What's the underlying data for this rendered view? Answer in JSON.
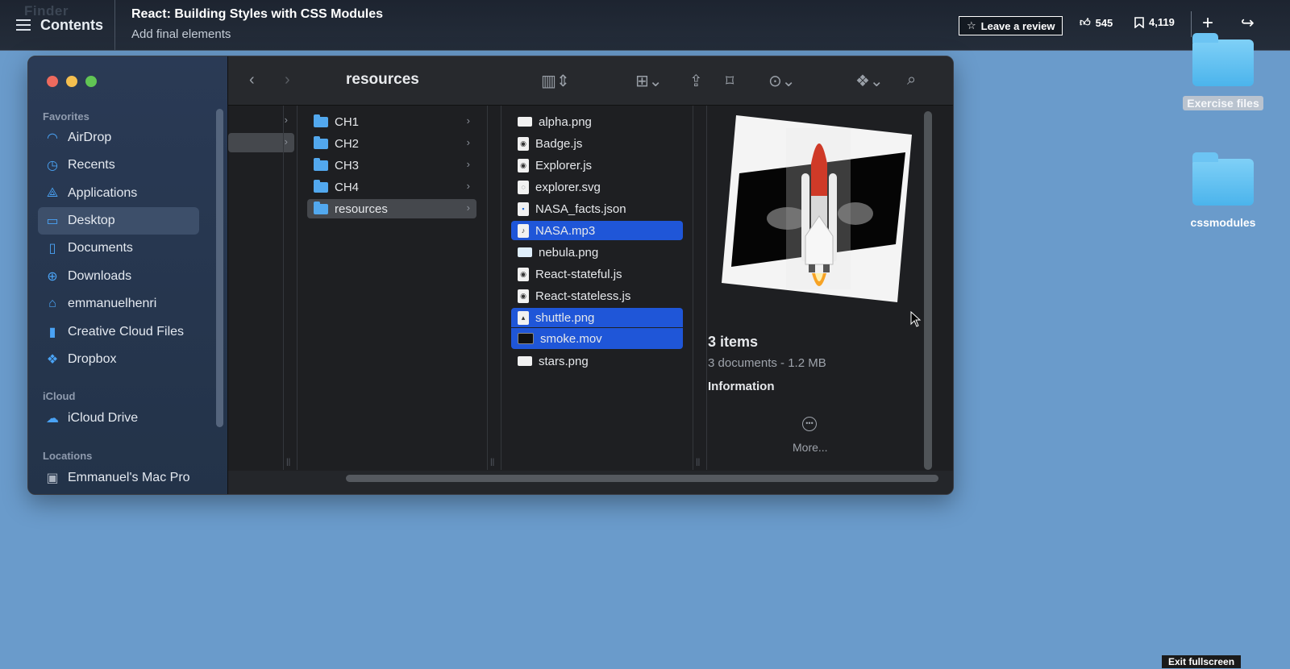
{
  "topbar": {
    "ghost_menu": "Finder",
    "contents_label": "Contents",
    "course_title": "React: Building Styles with CSS Modules",
    "video_title": "Add final elements",
    "review_label": "Leave a review",
    "likes": "545",
    "saves": "4,119"
  },
  "desktop": {
    "folders": [
      {
        "label": "Exercise files"
      },
      {
        "label": "cssmodules"
      }
    ]
  },
  "finder": {
    "title": "resources",
    "sidebar": {
      "favorites_heading": "Favorites",
      "favorites": [
        {
          "label": "AirDrop",
          "icon": "airdrop-icon"
        },
        {
          "label": "Recents",
          "icon": "clock-icon"
        },
        {
          "label": "Applications",
          "icon": "applications-icon"
        },
        {
          "label": "Desktop",
          "icon": "desktop-icon"
        },
        {
          "label": "Documents",
          "icon": "document-icon"
        },
        {
          "label": "Downloads",
          "icon": "download-icon"
        },
        {
          "label": "emmanuelhenri",
          "icon": "home-icon"
        },
        {
          "label": "Creative Cloud Files",
          "icon": "file-icon"
        },
        {
          "label": "Dropbox",
          "icon": "dropbox-icon"
        }
      ],
      "icloud_heading": "iCloud",
      "icloud": [
        {
          "label": "iCloud Drive",
          "icon": "cloud-icon"
        }
      ],
      "locations_heading": "Locations",
      "locations": [
        {
          "label": "Emmanuel's Mac Pro",
          "icon": "computer-icon"
        }
      ]
    },
    "folders_column": [
      "CH1",
      "CH2",
      "CH3",
      "CH4",
      "resources"
    ],
    "files_column": [
      {
        "name": "alpha.png",
        "icon": "image-file-icon"
      },
      {
        "name": "Badge.js",
        "icon": "js-file-icon"
      },
      {
        "name": "Explorer.js",
        "icon": "js-file-icon"
      },
      {
        "name": "explorer.svg",
        "icon": "svg-file-icon"
      },
      {
        "name": "NASA_facts.json",
        "icon": "json-file-icon"
      },
      {
        "name": "NASA.mp3",
        "icon": "audio-file-icon"
      },
      {
        "name": "nebula.png",
        "icon": "image-file-icon"
      },
      {
        "name": "React-stateful.js",
        "icon": "js-file-icon"
      },
      {
        "name": "React-stateless.js",
        "icon": "js-file-icon"
      },
      {
        "name": "shuttle.png",
        "icon": "image-file-icon"
      },
      {
        "name": "smoke.mov",
        "icon": "video-file-icon"
      },
      {
        "name": "stars.png",
        "icon": "image-file-icon"
      }
    ],
    "preview": {
      "count": "3 items",
      "size": "3 documents - 1.2 MB",
      "info_heading": "Information",
      "more": "More..."
    }
  },
  "exit_fullscreen": "Exit fullscreen",
  "colors": {
    "selection_blue": "#1f56d8",
    "desktop_bg": "#6a9bcb",
    "folder_blue": "#52a8ee"
  }
}
